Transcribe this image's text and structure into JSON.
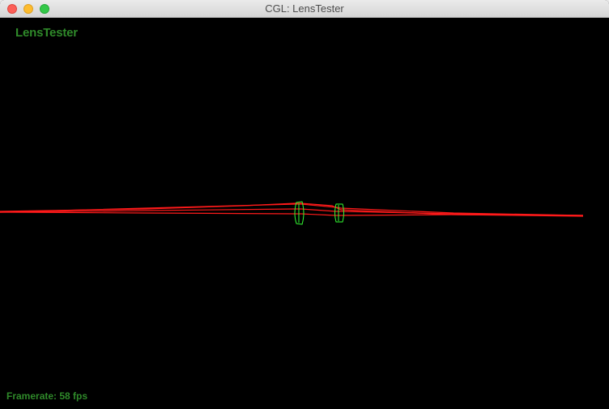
{
  "window": {
    "title": "CGL: LensTester"
  },
  "viewport": {
    "app_label": "LensTester",
    "framerate_text": "Framerate: 58 fps"
  },
  "colors": {
    "ray": "#ff1a1a",
    "lens": "#33ff33",
    "label": "#2f8a2a",
    "background": "#000000"
  },
  "icons": {
    "close": "close-icon",
    "minimize": "minimize-icon",
    "zoom": "zoom-icon"
  }
}
